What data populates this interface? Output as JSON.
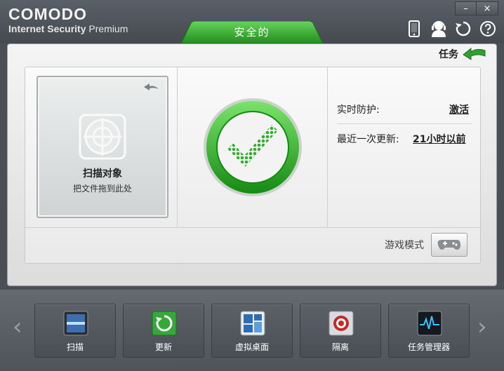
{
  "app": {
    "brand": "COMODO",
    "product_bold": "Internet Security",
    "product_edition": "Premium"
  },
  "window": {
    "minimize": "–",
    "close": "×"
  },
  "toolbar_icons": [
    "phone-icon",
    "support-icon",
    "refresh-icon",
    "help-icon"
  ],
  "status": {
    "label": "安全的",
    "color": "#2fa12c"
  },
  "tasks": {
    "label": "任务"
  },
  "scan_target": {
    "title": "扫描对象",
    "subtitle": "把文件拖到此处"
  },
  "protection": {
    "realtime_label": "实时防护:",
    "realtime_value": "激活",
    "update_label": "最近一次更新:",
    "update_value": "21小时以前"
  },
  "game_mode": {
    "label": "游戏模式"
  },
  "bottom_nav": {
    "prev": "‹",
    "next": "›",
    "items": [
      {
        "label": "扫描",
        "icon": "scan-icon"
      },
      {
        "label": "更新",
        "icon": "update-icon"
      },
      {
        "label": "虚拟桌面",
        "icon": "virtual-desktop-icon"
      },
      {
        "label": "隔离",
        "icon": "quarantine-icon"
      },
      {
        "label": "任务管理器",
        "icon": "task-manager-icon"
      }
    ]
  }
}
